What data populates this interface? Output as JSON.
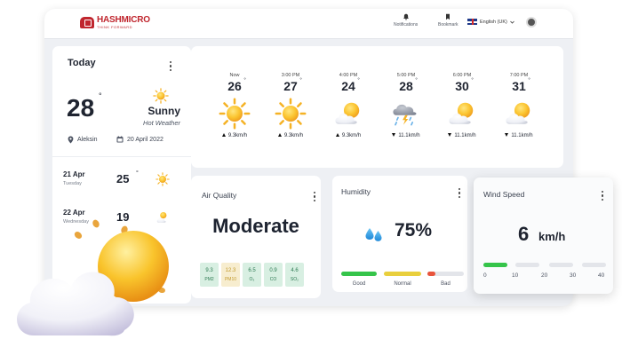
{
  "header": {
    "brand": "HASHMICRO",
    "tagline": "THINK FORWARD",
    "nav": [
      {
        "label": "Notifications",
        "icon": "bell-icon"
      },
      {
        "label": "Bookmark",
        "icon": "bookmark-icon"
      }
    ],
    "language": "English (UK)"
  },
  "today": {
    "title": "Today",
    "temperature": "28",
    "degree": "°",
    "condition": "Sunny",
    "subtitle": "Hot Weather",
    "location": "Aleksin",
    "date": "20 April 2022",
    "forecast": [
      {
        "date": "21 Apr",
        "day": "Tuesday",
        "temp": "25",
        "icon": "sun-icon"
      },
      {
        "date": "22 Apr",
        "day": "Wednesday",
        "temp": "19",
        "icon": "partly-cloudy-icon"
      }
    ]
  },
  "hourly": [
    {
      "time": "Now",
      "temp": "26",
      "icon": "sun-icon",
      "wind": "9.3km/h",
      "direction": "up"
    },
    {
      "time": "3:00 PM",
      "temp": "27",
      "icon": "sun-icon",
      "wind": "9.3km/h",
      "direction": "up"
    },
    {
      "time": "4:00 PM",
      "temp": "24",
      "icon": "partly-cloudy-icon",
      "wind": "9.3km/h",
      "direction": "up"
    },
    {
      "time": "5:00 PM",
      "temp": "28",
      "icon": "storm-icon",
      "wind": "11.1km/h",
      "direction": "down"
    },
    {
      "time": "6:00 PM",
      "temp": "30",
      "icon": "partly-cloudy-icon",
      "wind": "11.1km/h",
      "direction": "down"
    },
    {
      "time": "7:00 PM",
      "temp": "31",
      "icon": "partly-cloudy-icon",
      "wind": "11.1km/h",
      "direction": "down"
    }
  ],
  "air_quality": {
    "title": "Air Quality",
    "value": "Moderate",
    "pollutants": [
      {
        "value": "9.3",
        "label": "PM2",
        "level": "good"
      },
      {
        "value": "12.3",
        "label": "PM10",
        "level": "warn"
      },
      {
        "value": "6.5",
        "label": "O₃",
        "level": "good"
      },
      {
        "value": "0.9",
        "label": "CO",
        "level": "good"
      },
      {
        "value": "4.6",
        "label": "SO₂",
        "level": "good"
      }
    ]
  },
  "humidity": {
    "title": "Humidity",
    "value": "75%",
    "levels": [
      {
        "label": "Good",
        "color": "#35c44a"
      },
      {
        "label": "Normal",
        "color": "#e9cf3d"
      },
      {
        "label": "Bad",
        "color": "#e8543c"
      }
    ]
  },
  "wind": {
    "title": "Wind Speed",
    "value": "6",
    "unit": "km/h",
    "ticks": [
      "0",
      "10",
      "20",
      "30",
      "40"
    ],
    "level": 6
  },
  "colors": {
    "brand": "#c0262e",
    "good": "#35c44a",
    "normal": "#e9cf3d",
    "bad": "#e8543c"
  }
}
